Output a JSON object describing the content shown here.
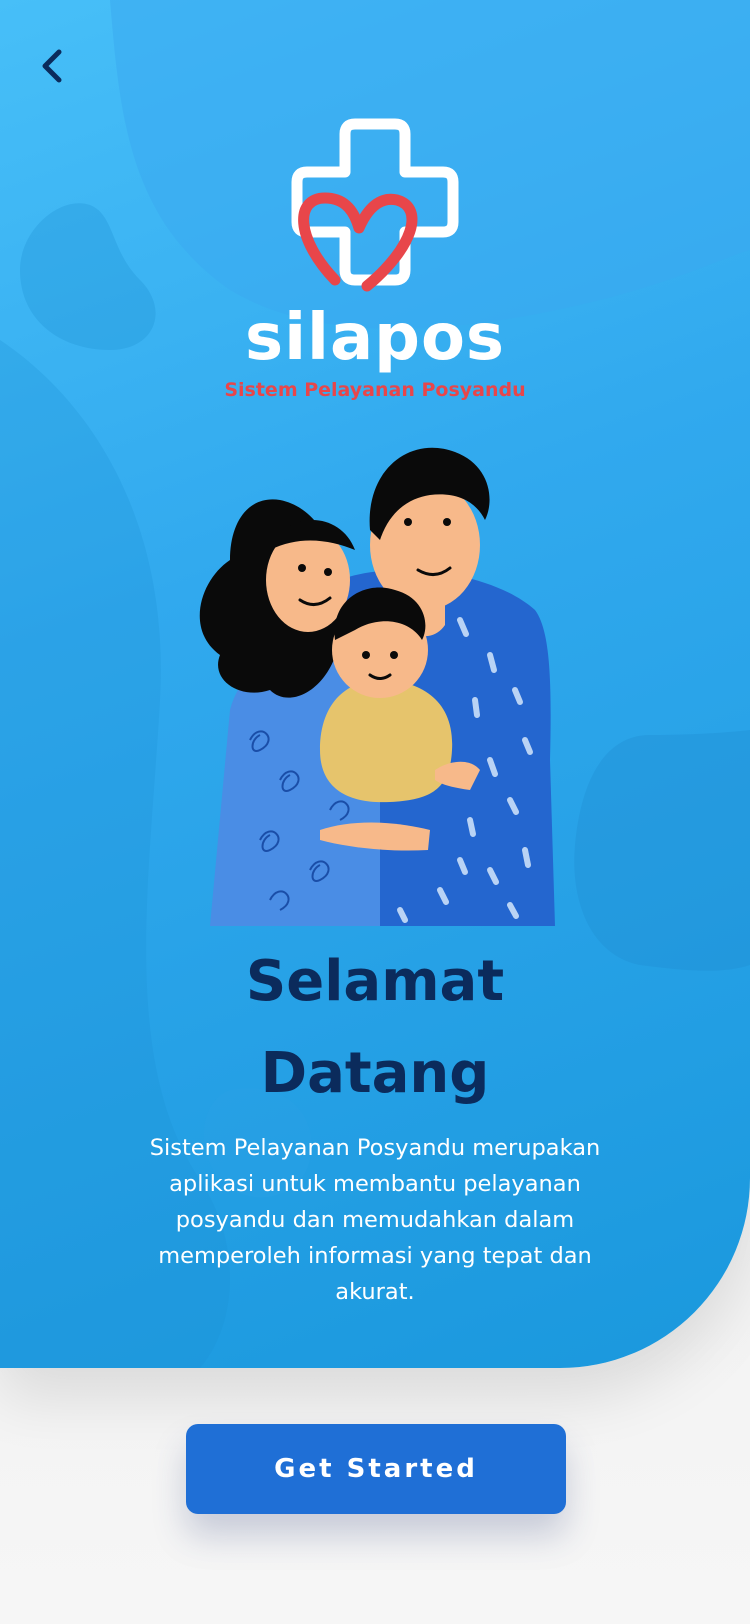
{
  "nav": {
    "back_icon": "chevron-left-icon"
  },
  "brand": {
    "name": "silapos",
    "tagline": "Sistem Pelayanan Posyandu",
    "logo_icon": "medical-cross-heart-logo",
    "colors": {
      "name": "#ffffff",
      "tagline": "#e8464a",
      "heart": "#e8464a"
    }
  },
  "illustration": {
    "icon": "family-illustration"
  },
  "welcome": {
    "title_line1": "Selamat",
    "title_line2": "Datang",
    "description": "Sistem Pelayanan Posyandu merupakan aplikasi untuk membantu pelayanan posyandu dan memudahkan dalam memperoleh informasi yang tepat dan akurat."
  },
  "cta": {
    "label": "Get Started"
  },
  "colors": {
    "hero_top": "#47bff8",
    "hero_bottom": "#1a98dd",
    "title": "#0b2b5c",
    "button": "#1f6fd6",
    "background": "#f4f4f4"
  }
}
